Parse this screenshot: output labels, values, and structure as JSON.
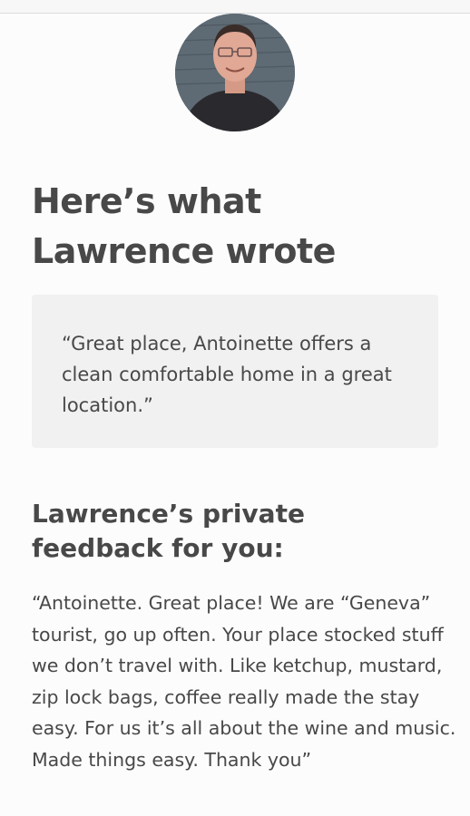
{
  "header": {
    "title_line1": "Here’s what",
    "title_line2": "Lawrence wrote"
  },
  "avatar": {
    "icon": "user-avatar-photo"
  },
  "public_review": {
    "text": "“Great place, Antoinette offers a clean comfortable home in a great location.”"
  },
  "private_feedback": {
    "title_line1": "Lawrence’s private",
    "title_line2": "feedback for you:",
    "text": "“Antoinette. Great place! We are “Geneva” tourist, go up often. Your place stocked stuff we don’t travel with. Like ketchup, mustard, zip lock bags, coffee really made the stay easy. For us it’s all about the wine and music. Made things easy. Thank you”"
  },
  "colors": {
    "text": "#484848",
    "quote_bg": "#f1f1f1",
    "page_bg": "#fcfcfc"
  }
}
